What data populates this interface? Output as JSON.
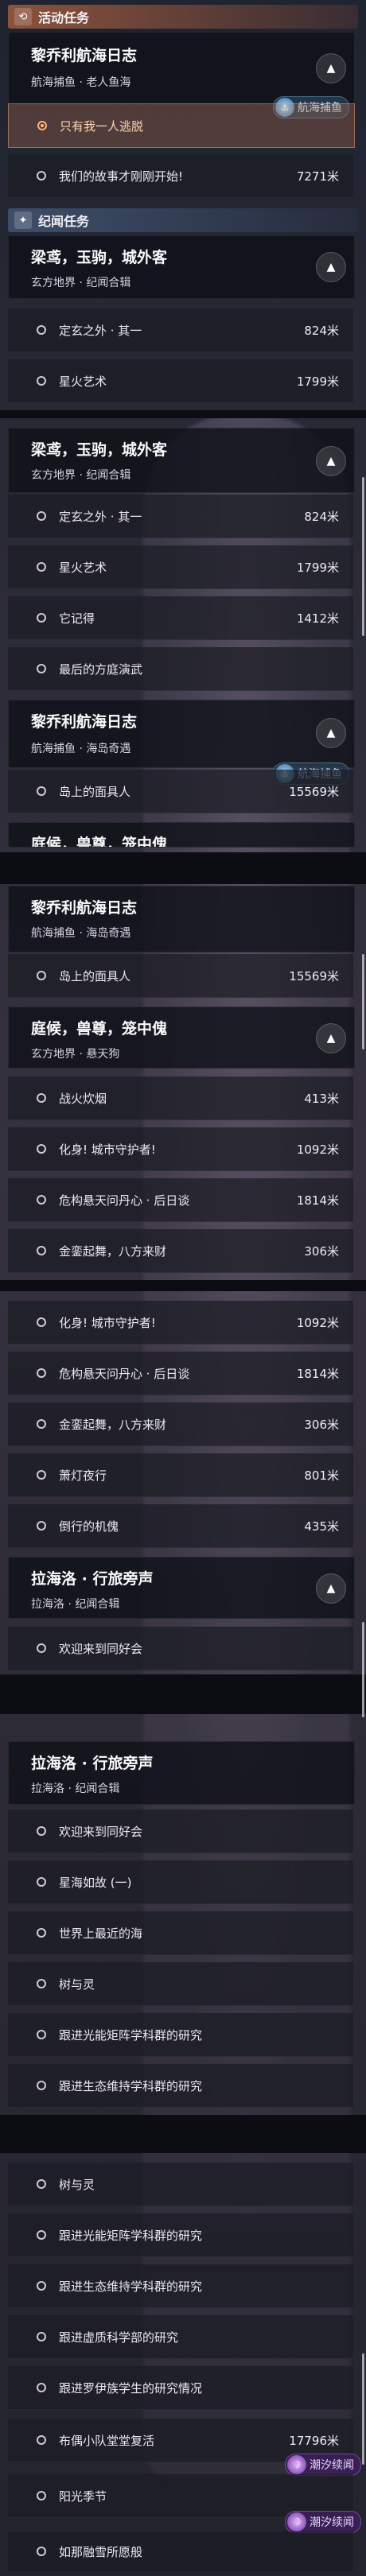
{
  "section_activity": {
    "title": "活动任务",
    "icon": "refresh-icon"
  },
  "section_legend": {
    "title": "纪闻任务",
    "icon": "sparkle-icon"
  },
  "groups": {
    "limerick_fishing_old": {
      "title": "黎乔利航海日志",
      "sub": "航海捕鱼 · 老人鱼海",
      "tag": "航海捕鱼"
    },
    "limerick_ocean": {
      "title": "黎乔利航海日志",
      "sub": "航海捕鱼 · 海岛奇遇",
      "tag": "航海捕鱼"
    },
    "liangyuan": {
      "title": "梁鸢，玉驹，城外客",
      "sub": "玄方地界 · 纪闻合辑"
    },
    "tinghou": {
      "title": "庭候，兽尊，笼中傀",
      "sub": "玄方地界 · 悬天狗"
    },
    "lahailuo": {
      "title": "拉海洛 · 行旅旁声",
      "sub": "拉海洛 · 纪闻合辑"
    },
    "cut_title": "庭候，兽尊，笼中傀"
  },
  "items": {
    "only_me_escape": "只有我一人逃脱",
    "our_story": "我们的故事才刚刚开始!",
    "our_story_dist": "7271米",
    "dingxuan": "定玄之外 · 其一",
    "dingxuan_dist": "824米",
    "xinghuo": "星火艺术",
    "xinghuo_dist": "1799米",
    "taji": "它记得",
    "taji_dist": "1412米",
    "fangting": "最后的方庭演武",
    "daoshang": "岛上的面具人",
    "daoshang_dist": "15569米",
    "zhanhuo": "战火炊烟",
    "zhanhuo_dist": "413米",
    "huashen": "化身! 城市守护者!",
    "huashen_dist": "1092米",
    "weiqiao": "危构悬天问丹心 · 后日谈",
    "weiqiao_dist": "1814米",
    "jinqian": "金銮起舞，八方来财",
    "jinqian_dist": "306米",
    "xiaodeng": "萧灯夜行",
    "xiaodeng_dist": "801米",
    "dahuo": "倒行的机傀",
    "dahuo_dist": "435米",
    "welcome": "欢迎来到同好会",
    "xinghai": "星海如故 (一)",
    "shijie": "世界上最近的海",
    "shuyuling": "树与灵",
    "guangneng": "跟进光能矩阵学科群的研究",
    "shengtai": "跟进生态维持学科群的研究",
    "xuzhi": "跟进虚质科学部的研究",
    "luoyi": "跟进罗伊族学生的研究情况",
    "budao": "布偶小队堂堂复活",
    "budao_dist": "17796米",
    "yangguang": "阳光季节",
    "rudao": "如那融雪所愿般"
  },
  "tags": {
    "chaoxi": "潮汐续闻"
  },
  "colors": {
    "accent_orange": "#e87a4a",
    "accent_blue": "#7ab0e6",
    "accent_purple": "#b070ff"
  }
}
